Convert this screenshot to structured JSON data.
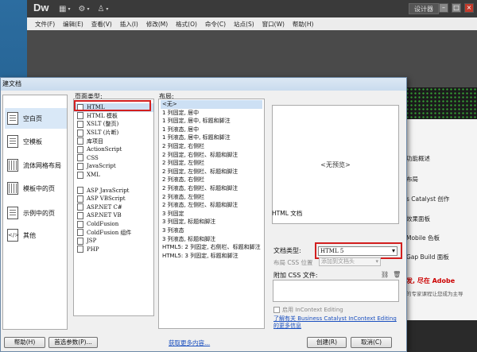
{
  "app": {
    "logo": "Dw",
    "workspace": "设计器",
    "menu": [
      "文件(F)",
      "编辑(E)",
      "查看(V)",
      "插入(I)",
      "修改(M)",
      "格式(O)",
      "命令(C)",
      "站点(S)",
      "窗口(W)",
      "帮助(H)"
    ]
  },
  "dialog": {
    "title": "建文档",
    "categories": [
      {
        "label": "空白页",
        "icon": "blank-page-icon"
      },
      {
        "label": "空模板",
        "icon": "blank-template-icon"
      },
      {
        "label": "流体网格布局",
        "icon": "fluid-grid-icon"
      },
      {
        "label": "模板中的页",
        "icon": "template-page-icon"
      },
      {
        "label": "示例中的页",
        "icon": "sample-page-icon"
      },
      {
        "label": "其他",
        "icon": "other-icon"
      }
    ],
    "page_type_label": "页面类型:",
    "page_types_a": [
      "HTML",
      "HTML 模板",
      "XSLT (整页)",
      "XSLT (片断)",
      "库项目",
      "ActionScript",
      "CSS",
      "JavaScript",
      "XML"
    ],
    "page_types_b": [
      "ASP JavaScript",
      "ASP VBScript",
      "ASP.NET C#",
      "ASP.NET VB",
      "ColdFusion",
      "ColdFusion 组件",
      "JSP",
      "PHP"
    ],
    "layout_label": "布局:",
    "layouts": [
      "<无>",
      "1 列固定, 居中",
      "1 列固定, 居中, 标题和脚注",
      "1 列液态, 居中",
      "1 列液态, 居中, 标题和脚注",
      "2 列固定, 右侧栏",
      "2 列固定, 右侧栏、标题和脚注",
      "2 列固定, 左侧栏",
      "2 列固定, 左侧栏、标题和脚注",
      "2 列液态, 右侧栏",
      "2 列液态, 右侧栏、标题和脚注",
      "2 列液态, 左侧栏",
      "2 列液态, 左侧栏、标题和脚注",
      "3 列固定",
      "3 列固定, 标题和脚注",
      "3 列液态",
      "3 列液态, 标题和脚注",
      "HTML5: 2 列固定, 右侧栏、标题和脚注",
      "HTML5: 3 列固定, 标题和脚注"
    ],
    "preview_text": "<无预览>",
    "description": "HTML 文档",
    "doctype_label": "文档类型:",
    "doctype_value": "HTML 5",
    "css_pos_label": "布局 CSS 位置",
    "css_pos_value": "添加到文档头",
    "attach_css_label": "附加 CSS 文件:",
    "incontext_label": "启用 InContext Editing",
    "bc_link": "了解有关 Business Catalyst InContext Editing 的更多信息",
    "help_btn": "帮助(H)",
    "prefs_btn": "首选参数(P)...",
    "more_link": "获取更多内容...",
    "create_btn": "创建(R)",
    "cancel_btn": "取消(C)"
  },
  "right_panel": {
    "items": [
      "功能概述",
      "布局",
      "s Catalyst 创作",
      "效果面板",
      "Mobile 色板",
      "Gap Build 面板"
    ],
    "adobe_text": "发, 尽在 Adobe",
    "adobe_sub": "的专家课程让您成为主导"
  }
}
